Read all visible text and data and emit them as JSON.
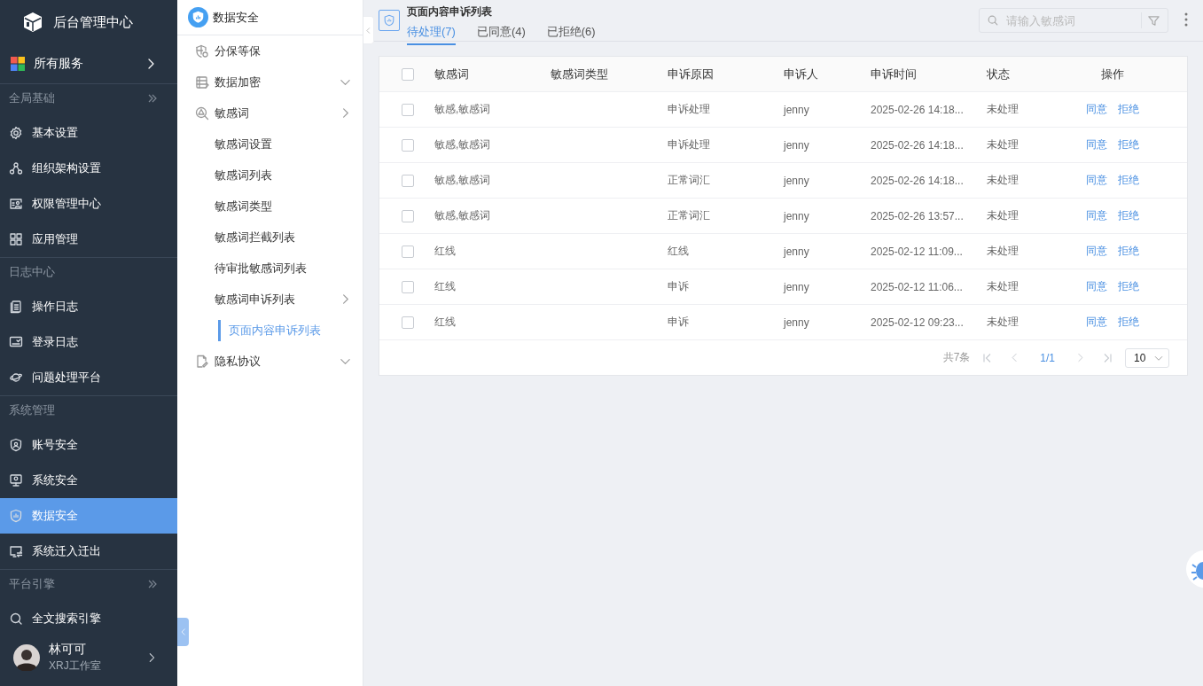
{
  "app": {
    "title": "后台管理中心"
  },
  "sidebar": {
    "services": {
      "label": "所有服务"
    },
    "groups": [
      {
        "label": "全局基础",
        "has_toggle": true,
        "items": [
          {
            "label": "基本设置",
            "selected": false
          },
          {
            "label": "组织架构设置",
            "selected": false
          },
          {
            "label": "权限管理中心",
            "selected": false
          },
          {
            "label": "应用管理",
            "selected": false
          }
        ]
      },
      {
        "label": "日志中心",
        "has_toggle": false,
        "items": [
          {
            "label": "操作日志",
            "selected": false
          },
          {
            "label": "登录日志",
            "selected": false
          },
          {
            "label": "问题处理平台",
            "selected": false
          }
        ]
      },
      {
        "label": "系统管理",
        "has_toggle": false,
        "items": [
          {
            "label": "账号安全",
            "selected": false
          },
          {
            "label": "系统安全",
            "selected": false
          },
          {
            "label": "数据安全",
            "selected": true
          },
          {
            "label": "系统迁入迁出",
            "selected": false
          }
        ]
      },
      {
        "label": "平台引擎",
        "has_toggle": true,
        "items": [
          {
            "label": "全文搜索引擎",
            "selected": false
          }
        ]
      }
    ],
    "user": {
      "name": "林可可",
      "org": "XRJ工作室"
    }
  },
  "submenu": {
    "title": "数据安全",
    "items": [
      {
        "label": "分保等保",
        "kind": "link",
        "selected": false
      },
      {
        "label": "数据加密",
        "kind": "folder",
        "expanded": false
      },
      {
        "label": "敏感词",
        "kind": "folder",
        "expanded": true,
        "children": [
          {
            "label": "敏感词设置",
            "kind": "link",
            "selected": false
          },
          {
            "label": "敏感词列表",
            "kind": "link",
            "selected": false
          },
          {
            "label": "敏感词类型",
            "kind": "link",
            "selected": false
          },
          {
            "label": "敏感词拦截列表",
            "kind": "link",
            "selected": false
          },
          {
            "label": "待审批敏感词列表",
            "kind": "link",
            "selected": false
          },
          {
            "label": "敏感词申诉列表",
            "kind": "folder",
            "expanded": true,
            "children": [
              {
                "label": "页面内容申诉列表",
                "kind": "link",
                "selected": true
              }
            ]
          }
        ]
      },
      {
        "label": "隐私协议",
        "kind": "folder",
        "expanded": false
      }
    ]
  },
  "page": {
    "title": "页面内容申诉列表",
    "tabs": [
      {
        "label": "待处理(7)",
        "selected": true
      },
      {
        "label": "已同意(4)",
        "selected": false
      },
      {
        "label": "已拒绝(6)",
        "selected": false
      }
    ],
    "search": {
      "placeholder": "请输入敏感词"
    }
  },
  "table": {
    "all_checked": false,
    "columns": [
      "敏感词",
      "敏感词类型",
      "申诉原因",
      "申诉人",
      "申诉时间",
      "状态",
      "操作"
    ],
    "rows": [
      {
        "checked": false,
        "word": "敏感,敏感词",
        "reason": "申诉处理",
        "user": "jenny",
        "time": "2025-02-26 14:18...",
        "status": "未处理",
        "actions": [
          "同意",
          "拒绝"
        ]
      },
      {
        "checked": false,
        "word": "敏感,敏感词",
        "reason": "申诉处理",
        "user": "jenny",
        "time": "2025-02-26 14:18...",
        "status": "未处理",
        "actions": [
          "同意",
          "拒绝"
        ]
      },
      {
        "checked": false,
        "word": "敏感,敏感词",
        "reason": "正常词汇",
        "user": "jenny",
        "time": "2025-02-26 14:18...",
        "status": "未处理",
        "actions": [
          "同意",
          "拒绝"
        ]
      },
      {
        "checked": false,
        "word": "敏感,敏感词",
        "reason": "正常词汇",
        "user": "jenny",
        "time": "2025-02-26 13:57...",
        "status": "未处理",
        "actions": [
          "同意",
          "拒绝"
        ]
      },
      {
        "checked": false,
        "word": "红线",
        "reason": "红线",
        "user": "jenny",
        "time": "2025-02-12 11:09...",
        "status": "未处理",
        "actions": [
          "同意",
          "拒绝"
        ]
      },
      {
        "checked": false,
        "word": "红线",
        "reason": "申诉",
        "user": "jenny",
        "time": "2025-02-12 11:06...",
        "status": "未处理",
        "actions": [
          "同意",
          "拒绝"
        ]
      },
      {
        "checked": false,
        "word": "红线",
        "reason": "申诉",
        "user": "jenny",
        "time": "2025-02-12 09:23...",
        "status": "未处理",
        "actions": [
          "同意",
          "拒绝"
        ]
      }
    ],
    "pagination": {
      "total": "共7条",
      "page": "1/1",
      "page_size": "10"
    }
  }
}
